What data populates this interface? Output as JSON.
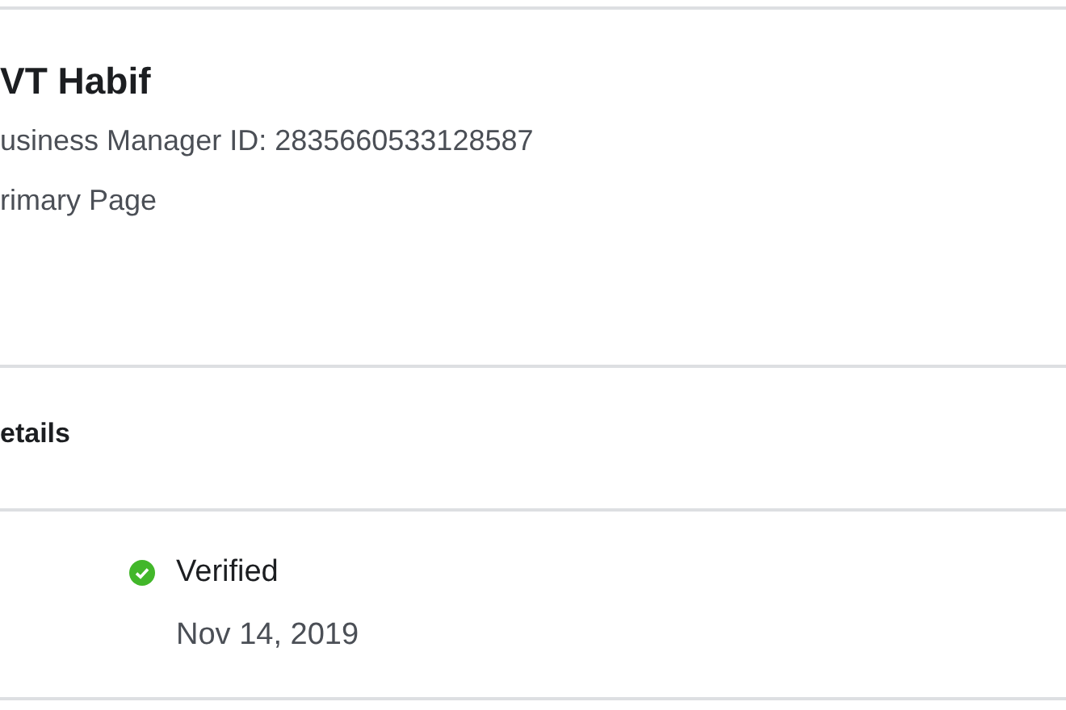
{
  "header": {
    "title": "VT Habif",
    "lines": [
      "usiness Manager ID: 2835660533128587",
      "rimary Page"
    ]
  },
  "details": {
    "heading": "etails",
    "status": {
      "label": "Verified",
      "verified": true
    },
    "date": "Nov 14, 2019"
  }
}
